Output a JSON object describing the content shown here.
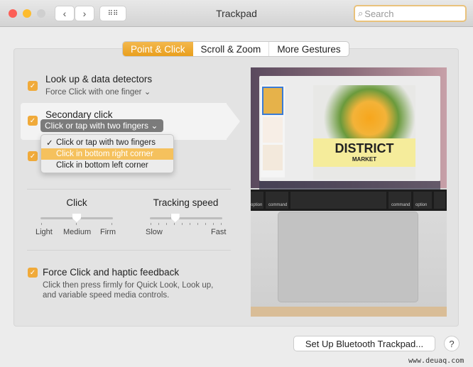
{
  "window": {
    "title": "Trackpad",
    "search_placeholder": "Search"
  },
  "tabs": [
    {
      "label": "Point & Click",
      "active": true
    },
    {
      "label": "Scroll & Zoom"
    },
    {
      "label": "More Gestures"
    }
  ],
  "options": {
    "lookup": {
      "label": "Look up & data detectors",
      "value": "Force Click with one finger",
      "checked": true
    },
    "secondary": {
      "label": "Secondary click",
      "value": "Click or tap with two fingers",
      "checked": true
    },
    "menu": [
      "Click or tap with two fingers",
      "Click in bottom right corner",
      "Click in bottom left corner"
    ],
    "menu_checked": "Click or tap with two fingers",
    "menu_highlighted": "Click in bottom right corner"
  },
  "click": {
    "title": "Click",
    "labels": [
      "Light",
      "Medium",
      "Firm"
    ],
    "value": "Medium"
  },
  "tracking": {
    "title": "Tracking speed",
    "min_label": "Slow",
    "max_label": "Fast",
    "value_fraction": 0.35
  },
  "force": {
    "label": "Force Click and haptic feedback",
    "desc": "Click then press firmly for Quick Look, Look up, and variable speed media controls.",
    "checked": true
  },
  "preview": {
    "headline": "DISTRICT",
    "subhead": "MARKET",
    "keys": [
      "option",
      "command",
      "command",
      "option"
    ]
  },
  "footer": {
    "bluetooth_button": "Set Up Bluetooth Trackpad...",
    "help": "?"
  },
  "watermark": "www.deuaq.com",
  "colors": {
    "accent": "#f0aa3a",
    "menu_highlight": "#f5c15d"
  }
}
